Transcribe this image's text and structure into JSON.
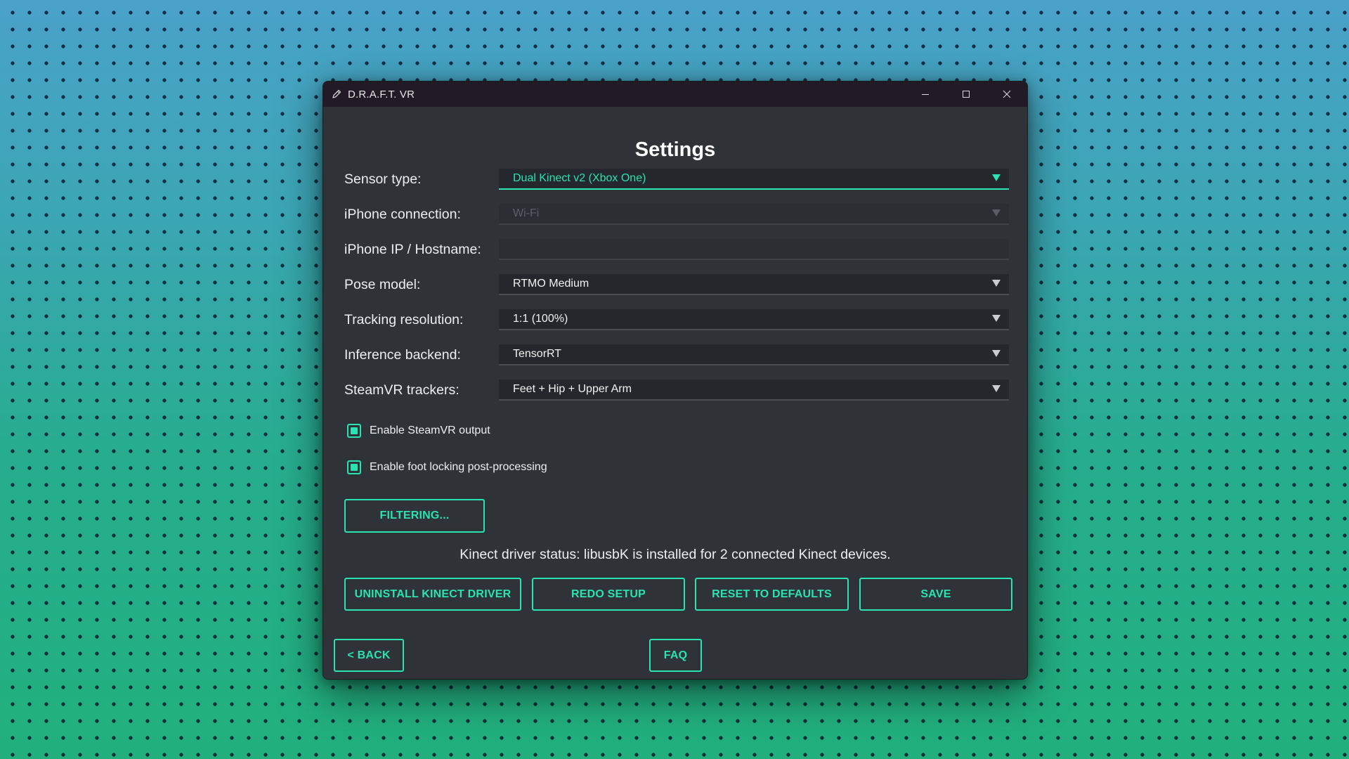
{
  "window": {
    "title": "D.R.A.F.T. VR",
    "controls": {
      "minimize": "minimize-icon",
      "maximize": "maximize-icon",
      "close": "close-icon"
    }
  },
  "page": {
    "title": "Settings"
  },
  "form": {
    "sensor_type": {
      "label": "Sensor type:",
      "value": "Dual Kinect v2 (Xbox One)",
      "state": "active"
    },
    "iphone_connection": {
      "label": "iPhone connection:",
      "value": "Wi-Fi",
      "state": "disabled"
    },
    "iphone_ip": {
      "label": "iPhone IP / Hostname:",
      "value": "",
      "state": "disabled"
    },
    "pose_model": {
      "label": "Pose model:",
      "value": "RTMO Medium"
    },
    "tracking_resolution": {
      "label": "Tracking resolution:",
      "value": "1:1 (100%)"
    },
    "inference_backend": {
      "label": "Inference backend:",
      "value": "TensorRT"
    },
    "steamvr_trackers": {
      "label": "SteamVR trackers:",
      "value": "Feet + Hip + Upper Arm"
    }
  },
  "checkboxes": {
    "steamvr_output": {
      "label": "Enable SteamVR output",
      "checked": true
    },
    "foot_locking": {
      "label": "Enable foot locking post-processing",
      "checked": true
    }
  },
  "buttons": {
    "filtering": "FILTERING...",
    "uninstall": "UNINSTALL KINECT DRIVER",
    "redo_setup": "REDO SETUP",
    "reset": "RESET TO DEFAULTS",
    "save": "SAVE",
    "back": "< BACK",
    "faq": "FAQ"
  },
  "status": {
    "driver_text": "Kinect driver status: libusbK is installed for 2 connected Kinect devices."
  },
  "colors": {
    "accent": "#29e3b0",
    "window_bg": "#2f3236",
    "titlebar_bg": "#221a25",
    "field_bg": "#24272b"
  }
}
